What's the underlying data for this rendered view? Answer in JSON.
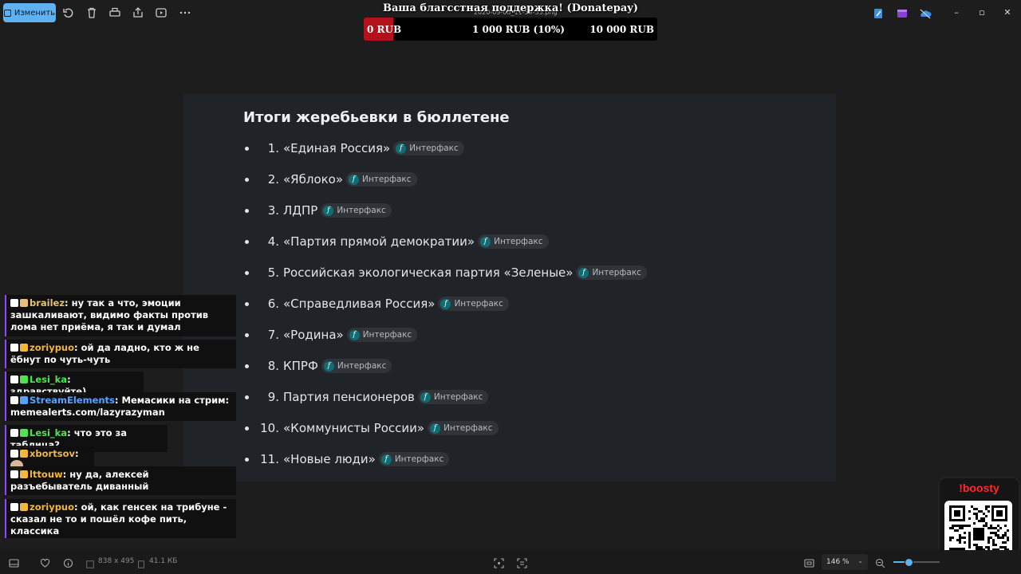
{
  "toolbar": {
    "edit_label": "Изменить",
    "filename": "2020-09-08_11-59-33.png"
  },
  "donation": {
    "title": "Ваша благсстная поддержка! (Donatepay)",
    "current": "0 RUB",
    "middle": "1 000 RUB (10%)",
    "goal": "10 000 RUB",
    "progress_fraction": 0.1
  },
  "card": {
    "title": "Итоги жеребьевки в бюллетене",
    "source": "Интерфакс",
    "items": [
      {
        "num": "1.",
        "text": "«Единая Россия»"
      },
      {
        "num": "2.",
        "text": "«Яблоко»"
      },
      {
        "num": "3.",
        "text": "ЛДПР"
      },
      {
        "num": "4.",
        "text": "«Партия прямой демократии»"
      },
      {
        "num": "5.",
        "text": "Российская экологическая партия «Зеленые»"
      },
      {
        "num": "6.",
        "text": "«Справедливая Россия»"
      },
      {
        "num": "7.",
        "text": "«Родина»"
      },
      {
        "num": "8.",
        "text": "КПРФ"
      },
      {
        "num": "9.",
        "text": "Партия пенсионеров"
      },
      {
        "num": "10.",
        "text": "«Коммунисты России»"
      },
      {
        "num": "11.",
        "text": "«Новые люди»"
      }
    ]
  },
  "chat": [
    {
      "user": "brailez",
      "color": "#e8c07a",
      "text": "ну так а что, эмоции зашкаливают, видимо факты против лома нет приёма, я так и думал"
    },
    {
      "user": "zoriypuo",
      "color": "#f4b63c",
      "text": "ой да ладно, кто ж не ёбнут по чуть-чуть"
    },
    {
      "user": "Lesi_ka",
      "color": "#4fe34f",
      "text": "здравствуйте)"
    },
    {
      "user": "StreamElements",
      "color": "#5aa0ff",
      "text": "Мемасики на стрим: memealerts.com/lazyrazyman"
    },
    {
      "user": "Lesi_ka",
      "color": "#4fe34f",
      "text": "что это за таблица?"
    },
    {
      "user": "xbortsov",
      "color": "#f4b63c",
      "text": ""
    },
    {
      "user": "lttouw",
      "color": "#f4b63c",
      "text": "ну да, алексей разъебыватель диванный"
    },
    {
      "user": "zoriypuo",
      "color": "#f4b63c",
      "text": "ой, как генсек на трибуне - сказал не то и пошёл кофе пить, классика"
    }
  ],
  "boosty": {
    "title": "!boosty"
  },
  "status": {
    "dimensions": "838 x 495",
    "filesize": "41.1 КБ",
    "zoom": "146 %"
  }
}
